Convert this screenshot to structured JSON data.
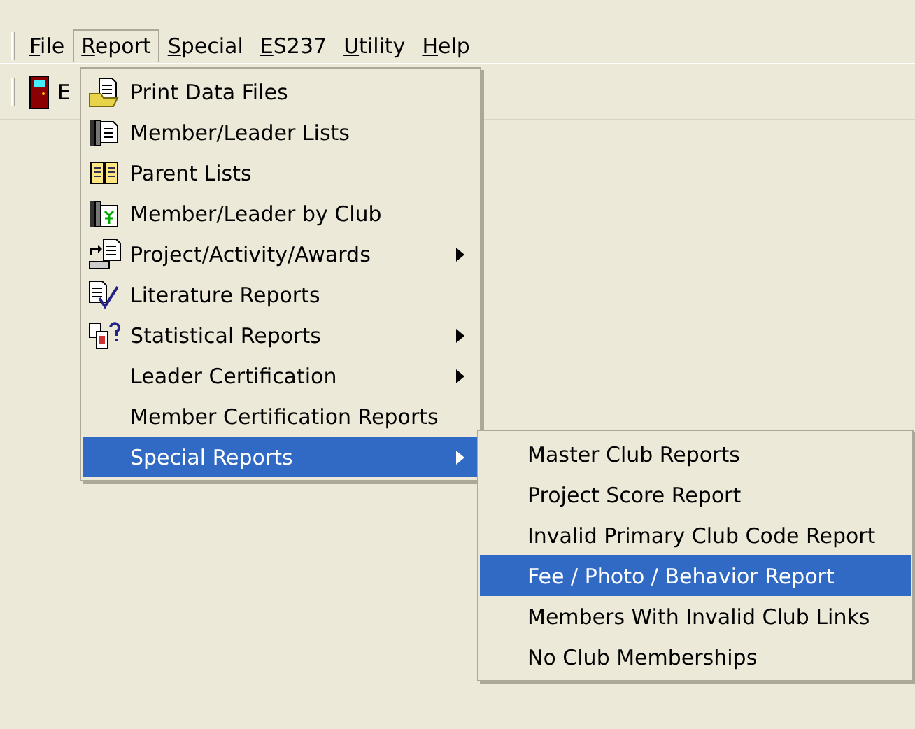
{
  "menubar": [
    {
      "label": "File",
      "selected": false
    },
    {
      "label": "Report",
      "selected": true
    },
    {
      "label": "Special",
      "selected": false
    },
    {
      "label": "ES237",
      "selected": false
    },
    {
      "label": "Utility",
      "selected": false
    },
    {
      "label": "Help",
      "selected": false
    }
  ],
  "toolbar": {
    "button_label": "E"
  },
  "report_menu": [
    {
      "label": "Print Data Files",
      "has_submenu": false,
      "selected": false
    },
    {
      "label": "Member/Leader Lists",
      "has_submenu": false,
      "selected": false
    },
    {
      "label": "Parent Lists",
      "has_submenu": false,
      "selected": false
    },
    {
      "label": "Member/Leader by Club",
      "has_submenu": false,
      "selected": false
    },
    {
      "label": "Project/Activity/Awards",
      "has_submenu": true,
      "selected": false
    },
    {
      "label": "Literature Reports",
      "has_submenu": false,
      "selected": false
    },
    {
      "label": "Statistical Reports",
      "has_submenu": true,
      "selected": false
    },
    {
      "label": "Leader Certification",
      "has_submenu": true,
      "selected": false
    },
    {
      "label": "Member Certification Reports",
      "has_submenu": false,
      "selected": false
    },
    {
      "label": "Special Reports",
      "has_submenu": true,
      "selected": true
    }
  ],
  "special_reports_menu": [
    {
      "label": "Master Club Reports",
      "selected": false
    },
    {
      "label": "Project Score Report",
      "selected": false
    },
    {
      "label": "Invalid Primary Club Code Report",
      "selected": false
    },
    {
      "label": "Fee / Photo / Behavior Report",
      "selected": true
    },
    {
      "label": "Members With Invalid Club Links",
      "selected": false
    },
    {
      "label": "No Club Memberships",
      "selected": false
    }
  ]
}
